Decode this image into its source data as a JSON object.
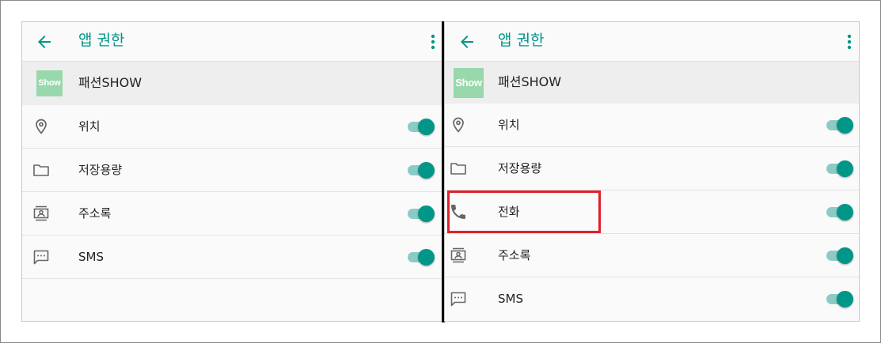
{
  "left_panel": {
    "title": "앱 권한",
    "app_icon_text": "Show",
    "app_name": "패션SHOW",
    "permissions": [
      {
        "label": "위치",
        "icon": "location-icon",
        "enabled": true
      },
      {
        "label": "저장용량",
        "icon": "folder-icon",
        "enabled": true
      },
      {
        "label": "주소록",
        "icon": "contacts-icon",
        "enabled": true
      },
      {
        "label": "SMS",
        "icon": "sms-icon",
        "enabled": true
      }
    ]
  },
  "right_panel": {
    "title": "앱 권한",
    "app_icon_text": "Show",
    "app_name": "패션SHOW",
    "permissions": [
      {
        "label": "위치",
        "icon": "location-icon",
        "enabled": true
      },
      {
        "label": "저장용량",
        "icon": "folder-icon",
        "enabled": true
      },
      {
        "label": "전화",
        "icon": "phone-icon",
        "enabled": true,
        "highlighted": true
      },
      {
        "label": "주소록",
        "icon": "contacts-icon",
        "enabled": true
      },
      {
        "label": "SMS",
        "icon": "sms-icon",
        "enabled": true
      }
    ]
  },
  "colors": {
    "accent": "#009688",
    "toggle_track": "#8ccbc3",
    "highlight": "#e0202a",
    "app_icon_bg": "#98d8ac"
  }
}
